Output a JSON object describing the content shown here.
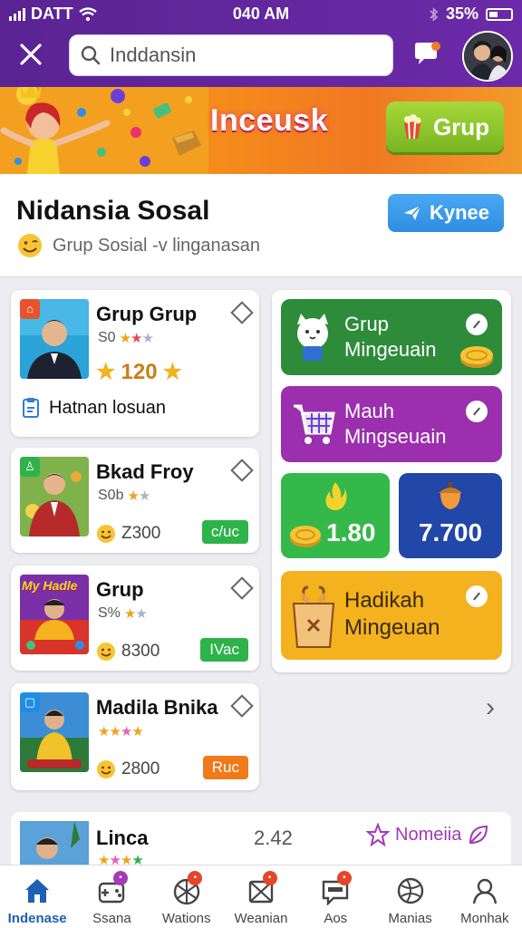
{
  "status_bar": {
    "carrier": "DATT",
    "time": "040 AM",
    "battery": "35%"
  },
  "header": {
    "search_value": "Inddansin"
  },
  "banner": {
    "title": "Inceusk",
    "button_label": "Grup"
  },
  "profile": {
    "title": "Nidansia Sosal",
    "subtitle": "Grup Sosial -v linganasan",
    "action_label": "Kynee"
  },
  "cards": [
    {
      "title": "Grup Grup",
      "meta": "S0",
      "count": "120",
      "footer": "Hatnan losuan",
      "badge_color": "#e8532b"
    },
    {
      "title": "Bkad Froy",
      "meta": "S0b",
      "count": "Z300",
      "pill": "c/uc",
      "pill_color": "#2db34a",
      "badge_color": "#2db34a"
    },
    {
      "title": "Grup",
      "meta": "S%",
      "count": "8300",
      "pill": "IVac",
      "pill_color": "#2db34a",
      "thumb_text": "My Hadle"
    },
    {
      "title": "Madila Bnika",
      "meta": "",
      "count": "2800",
      "pill": "Ruc",
      "pill_color": "#f07a1a",
      "badge_color": "#1f8de0"
    }
  ],
  "tiles": [
    {
      "label_line1": "Grup",
      "label_line2": "Mingeuain",
      "color": "#2e8b3a"
    },
    {
      "label_line1": "Mauh",
      "label_line2": "Mingseuain",
      "color": "#9b2fae"
    },
    {
      "value": "1.80",
      "color": "#35b84a"
    },
    {
      "value": "7.700",
      "color": "#2147a8"
    },
    {
      "label_line1": "Hadikah",
      "label_line2": "Mingeuan",
      "color": "#f3b21e"
    }
  ],
  "bottom_card": {
    "title": "Linca",
    "value": "2.42",
    "tag": "Nomeiia"
  },
  "nav": [
    {
      "label": "Indenase",
      "active": true
    },
    {
      "label": "Ssana"
    },
    {
      "label": "Wations"
    },
    {
      "label": "Weanian"
    },
    {
      "label": "Aos"
    },
    {
      "label": "Manias"
    },
    {
      "label": "Monhak"
    }
  ]
}
